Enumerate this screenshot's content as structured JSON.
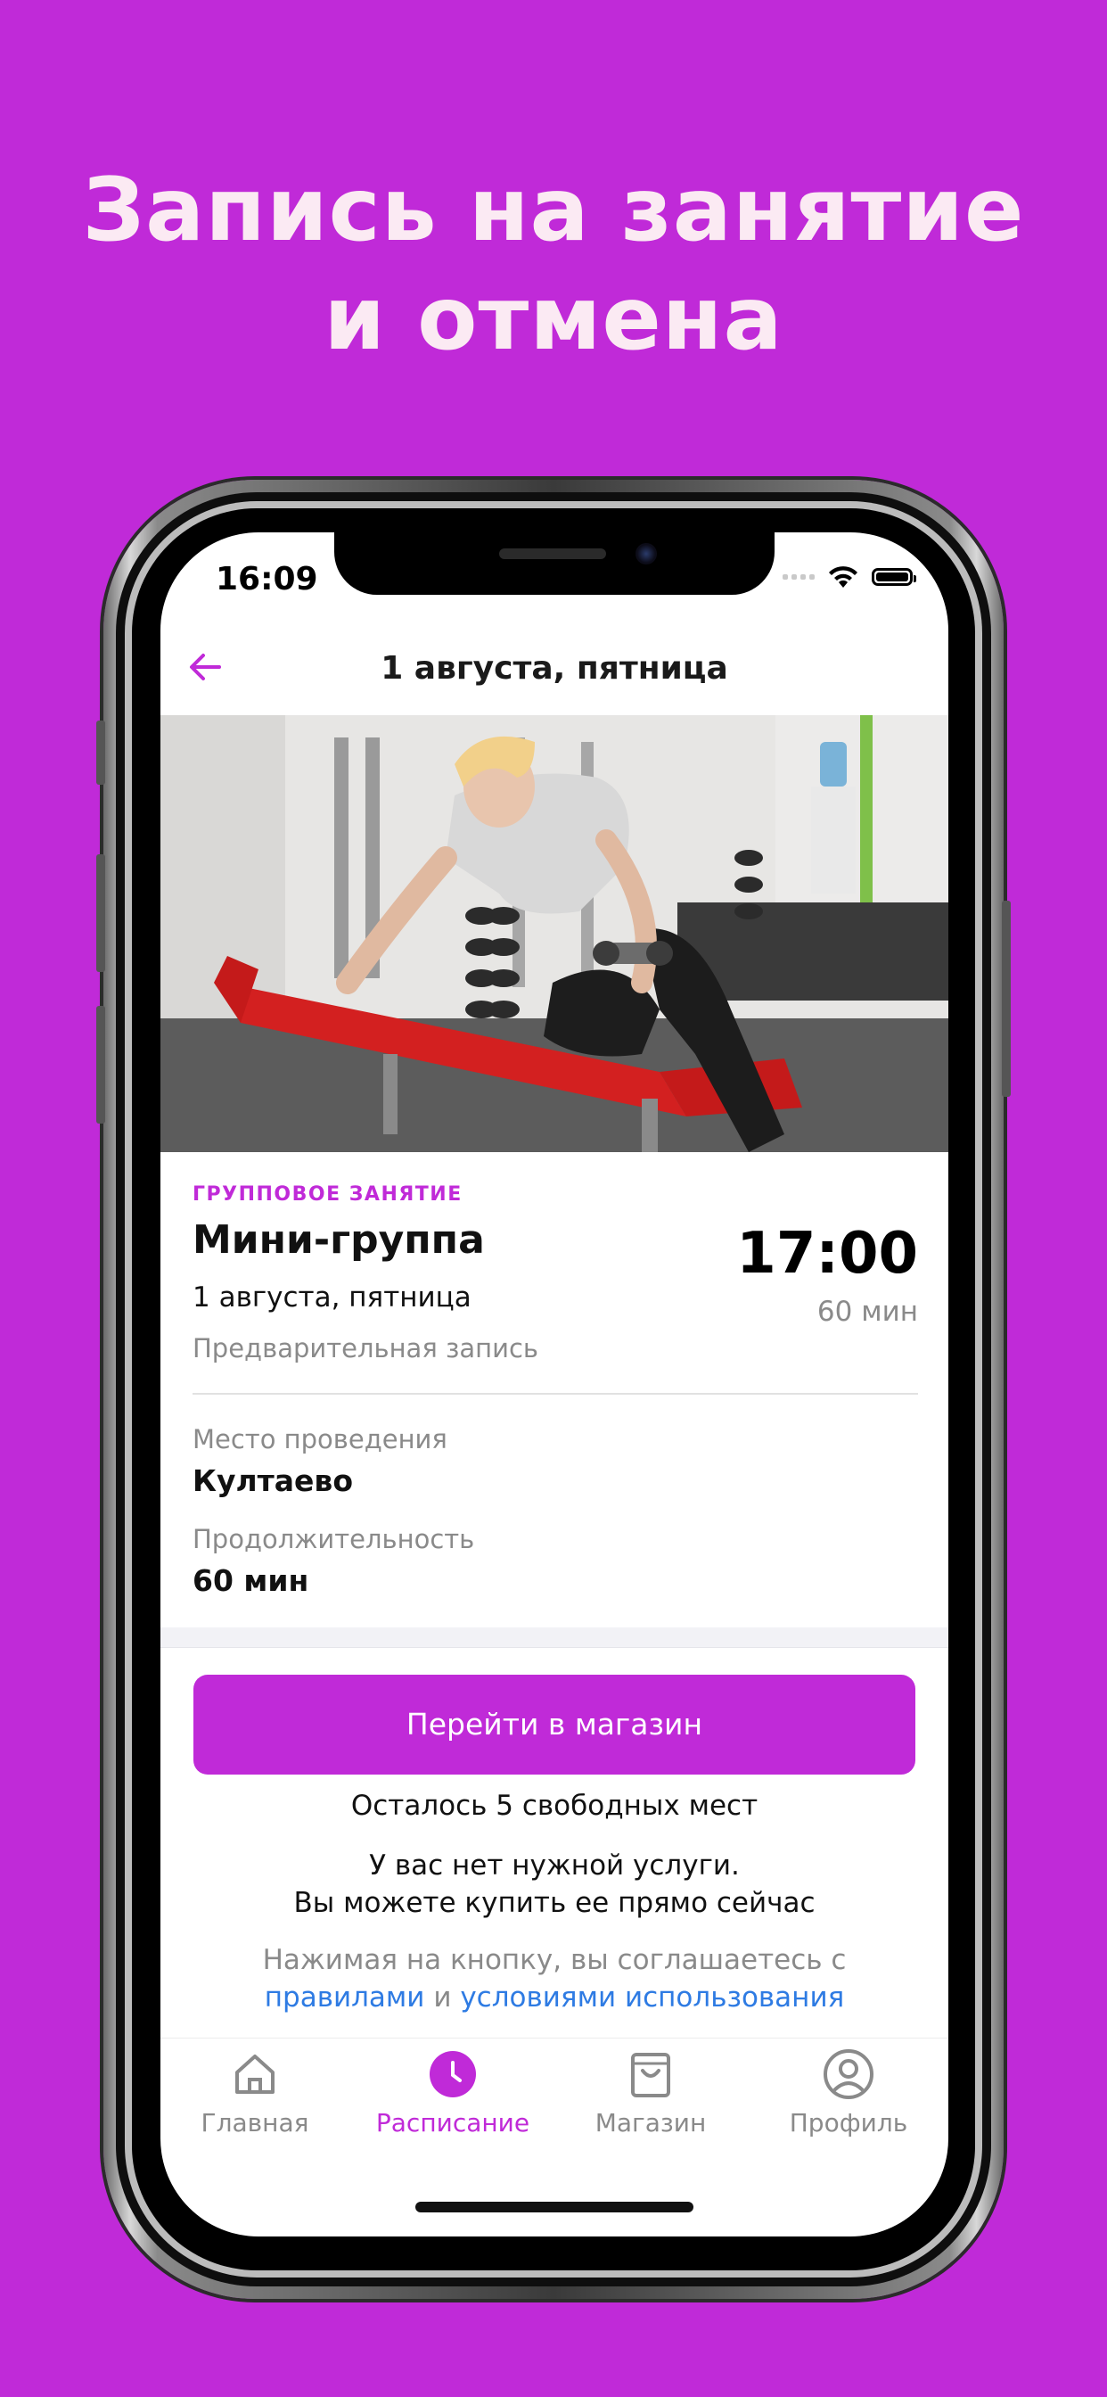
{
  "headline": {
    "line1": "Запись на занятие",
    "line2": "и отмена"
  },
  "status_bar": {
    "time": "16:09"
  },
  "nav": {
    "title": "1 августа, пятница"
  },
  "class": {
    "category": "ГРУППОВОЕ ЗАНЯТИЕ",
    "name": "Мини-группа",
    "date": "1 августа, пятница",
    "booking": "Предварительная запись",
    "time": "17:00",
    "duration": "60 мин"
  },
  "details": {
    "place_label": "Место проведения",
    "place_value": "Култаево",
    "duration_label": "Продолжительность",
    "duration_value": "60 мин"
  },
  "actions": {
    "shop_button": "Перейти в магазин",
    "seats_left": "Осталось 5 свободных мест",
    "no_service_line1": "У вас нет нужной услуги.",
    "no_service_line2": "Вы можете купить ее прямо сейчас",
    "agree_text": "Нажимая на кнопку, вы соглашаетесь с",
    "agree_rules": "правилами",
    "agree_and": "и",
    "agree_terms": "условиями использования"
  },
  "tabs": [
    {
      "label": "Главная",
      "icon": "home-icon",
      "active": false
    },
    {
      "label": "Расписание",
      "icon": "clock-icon",
      "active": true
    },
    {
      "label": "Магазин",
      "icon": "shopping-bag-icon",
      "active": false
    },
    {
      "label": "Профиль",
      "icon": "user-icon",
      "active": false
    }
  ],
  "colors": {
    "accent": "#c02ad8",
    "link": "#2e7be3",
    "muted": "#8a8a8a"
  }
}
